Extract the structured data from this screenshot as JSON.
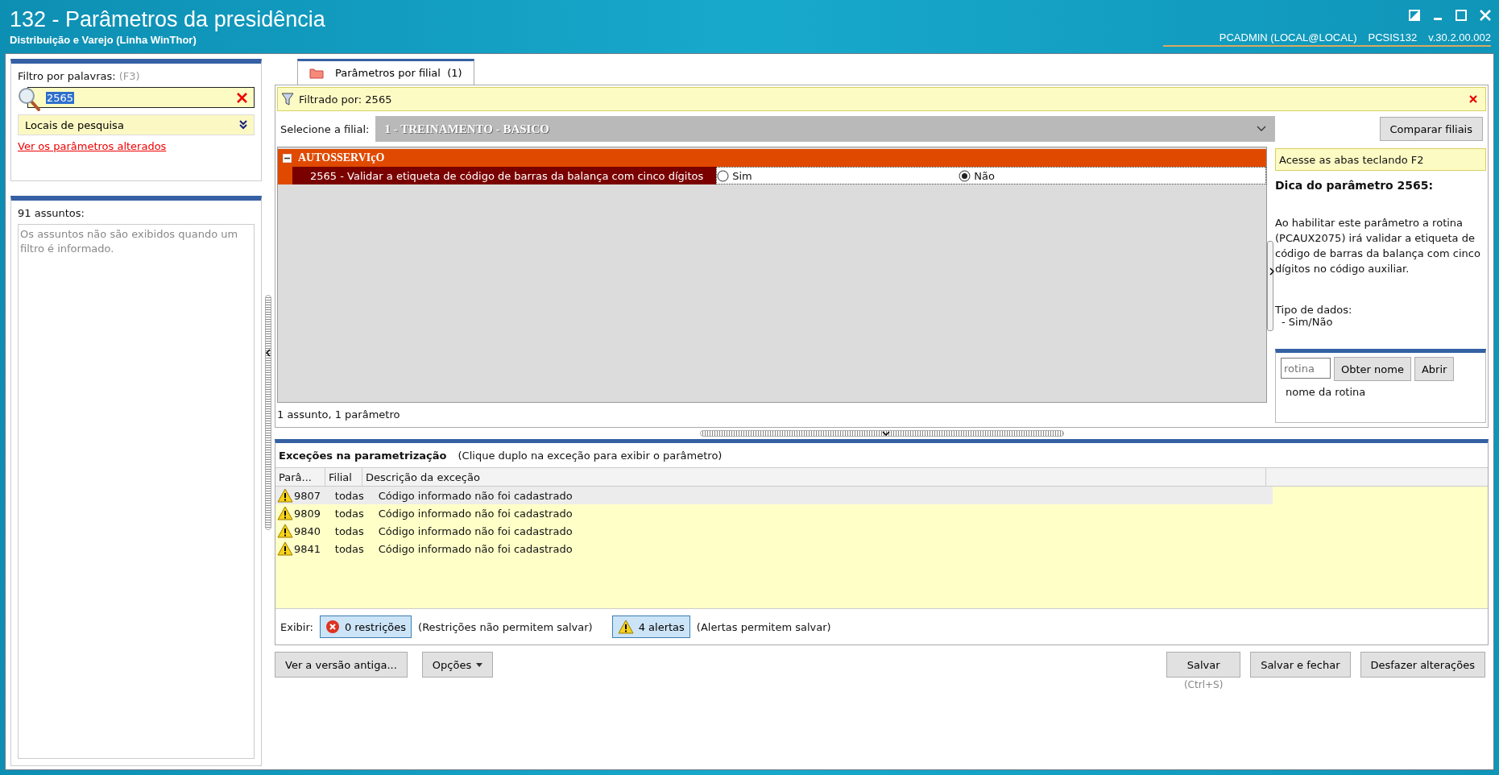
{
  "window": {
    "title": "132 - Parâmetros da presidência",
    "subtitle": "Distribuição e Varejo (Linha WinThor)",
    "user": "PCADMIN (LOCAL@LOCAL)",
    "program": "PCSIS132",
    "version": "v.30.2.00.002"
  },
  "filter": {
    "label": "Filtro por palavras:",
    "shortcut": "(F3)",
    "value": "2565",
    "locations": "Locais de pesquisa",
    "changed_link": "Ver os parâmetros alterados"
  },
  "subjects": {
    "count_label": "91 assuntos:",
    "message": "Os assuntos não são exibidos quando um filtro é informado."
  },
  "tabs": [
    {
      "label": "Parâmetros por filial",
      "count": "(1)",
      "selected": true
    }
  ],
  "filter_banner": "Filtrado por: 2565",
  "branch": {
    "label": "Selecione a filial:",
    "value": "1 - TREINAMENTO - BASICO",
    "disabled": true
  },
  "compare_button": "Comparar filiais",
  "groups": [
    {
      "name": "AUTOSSERVIçO",
      "expanded": true,
      "parameters": [
        {
          "label": "2565 - Validar a etiqueta de código de barras da balança com cinco dígitos",
          "selected": true,
          "options": [
            {
              "label": "Sim",
              "selected": false
            },
            {
              "label": "Não",
              "selected": true
            }
          ]
        }
      ]
    }
  ],
  "grid_status": "1 assunto, 1 parâmetro",
  "hint": {
    "banner": "Acesse as abas teclando F2",
    "title": "Dica do parâmetro 2565:",
    "text": "Ao habilitar este parâmetro a rotina (PCAUX2075) irá validar a etiqueta de código de barras da balança com cinco dígitos no código auxiliar.",
    "data_type_label": "Tipo de dados:",
    "data_type_value": "- Sim/Não"
  },
  "routine": {
    "placeholder": "rotina",
    "get_name_button": "Obter nome",
    "open_button": "Abrir",
    "name_label": "nome da rotina"
  },
  "exceptions": {
    "title": "Exceções na parametrização",
    "subtitle": "(Clique duplo na exceção para exibir o parâmetro)",
    "columns": [
      "Parâ...",
      "Filial",
      "Descrição da exceção"
    ],
    "rows": [
      {
        "kind": "warning",
        "param": "9807",
        "branch": "todas",
        "description": "Código informado não foi cadastrado",
        "selected": true
      },
      {
        "kind": "warning",
        "param": "9809",
        "branch": "todas",
        "description": "Código informado não foi cadastrado",
        "selected": false
      },
      {
        "kind": "warning",
        "param": "9840",
        "branch": "todas",
        "description": "Código informado não foi cadastrado",
        "selected": false
      },
      {
        "kind": "warning",
        "param": "9841",
        "branch": "todas",
        "description": "Código informado não foi cadastrado",
        "selected": false
      }
    ]
  },
  "show": {
    "label": "Exibir:",
    "filters": [
      {
        "kind": "error",
        "label": "0 restrições",
        "note": "(Restrições não permitem salvar)",
        "selected": true
      },
      {
        "kind": "warning",
        "label": "4 alertas",
        "note": "(Alertas permitem salvar)",
        "selected": true
      }
    ]
  },
  "footer": {
    "left_buttons": [
      {
        "kind": "plain",
        "label": "Ver a versão antiga..."
      },
      {
        "kind": "menu",
        "label": "Opções"
      }
    ],
    "right_buttons": [
      {
        "label": "Salvar",
        "shortcut": "(Ctrl+S)"
      },
      {
        "label": "Salvar e fechar"
      },
      {
        "label": "Desfazer alterações"
      }
    ]
  }
}
